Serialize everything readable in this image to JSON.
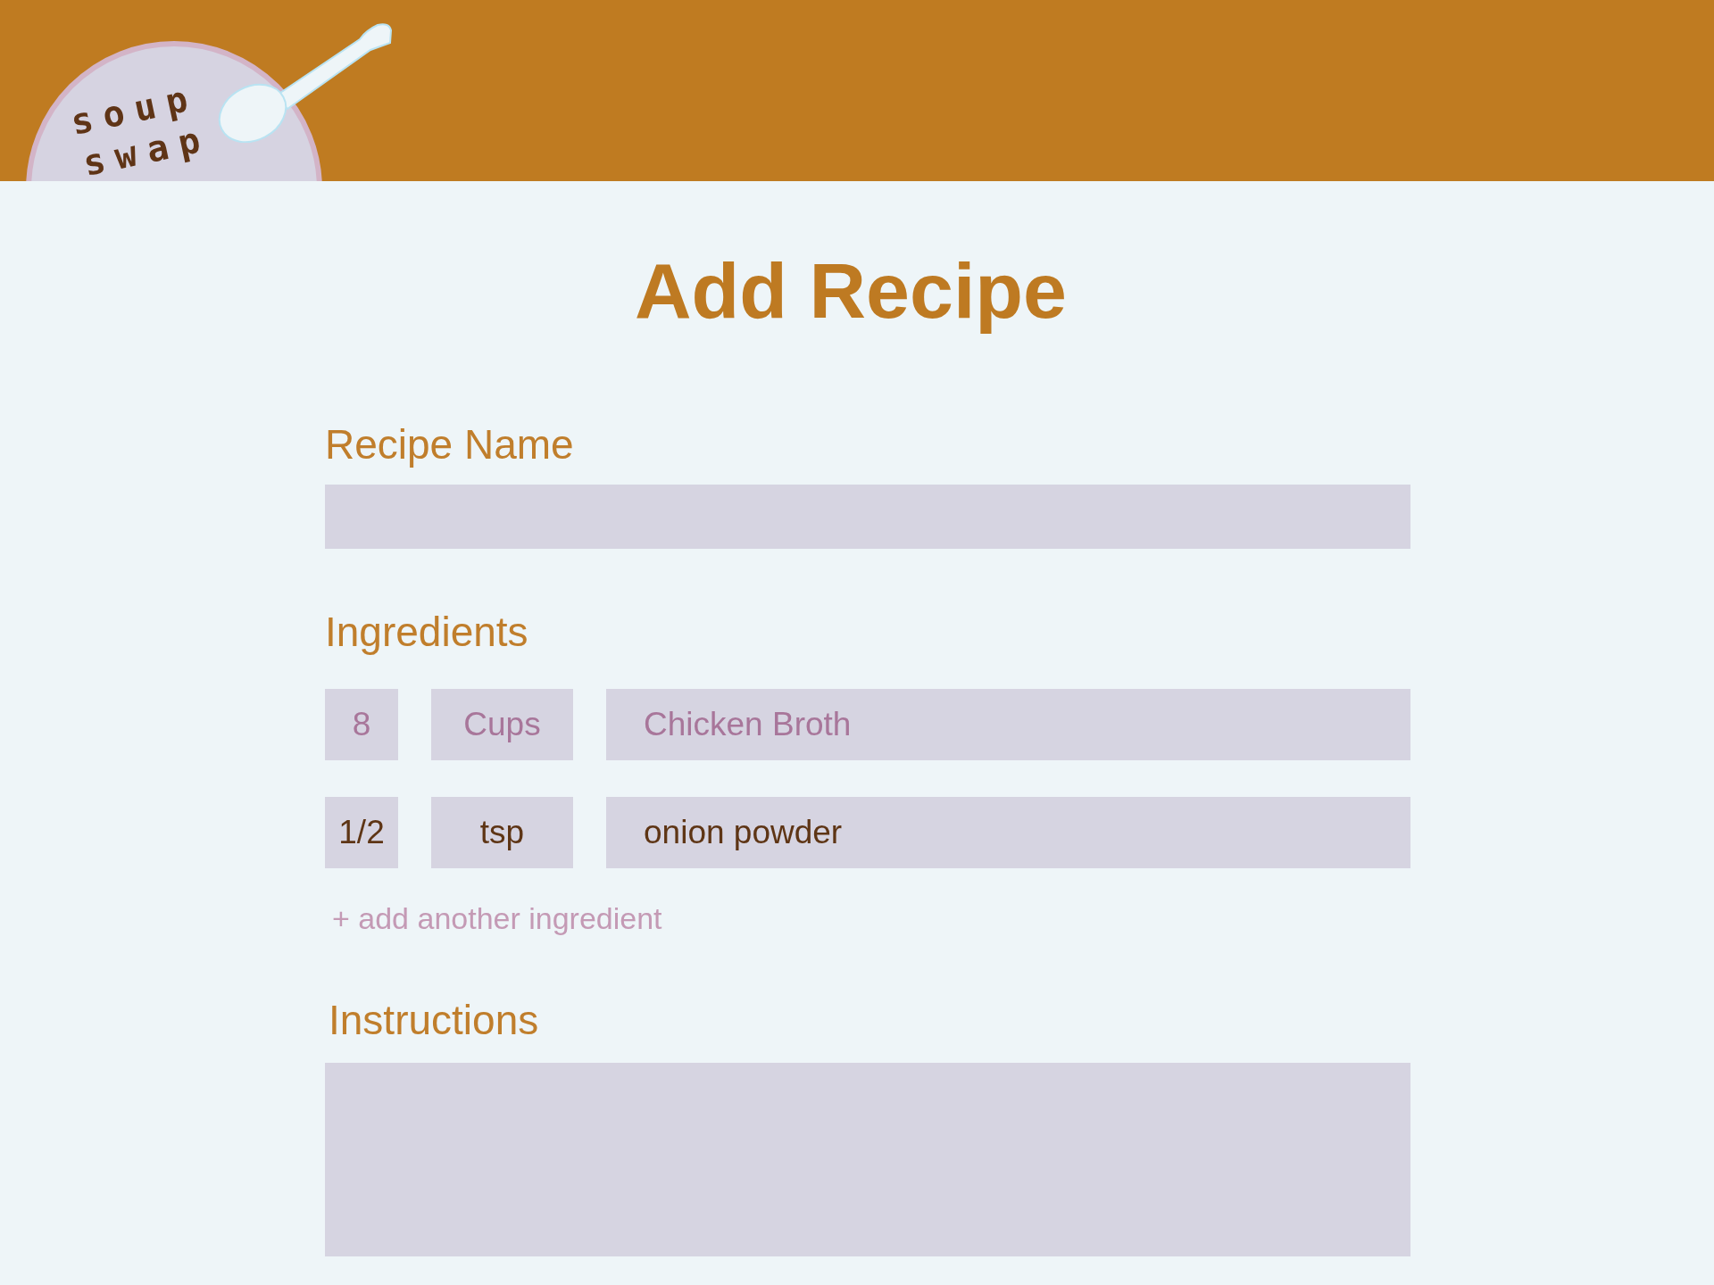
{
  "header": {
    "logo": {
      "line_1": "soup",
      "line_2": "swap"
    }
  },
  "title": "Add Recipe",
  "form": {
    "recipe_name": {
      "label": "Recipe Name"
    },
    "ingredients": {
      "label": "Ingredients",
      "rows": [
        {
          "quantity": {
            "placeholder": "8"
          },
          "unit": {
            "placeholder": "Cups"
          },
          "name": {
            "placeholder": "Chicken Broth"
          }
        },
        {
          "quantity": {
            "value": "1/2"
          },
          "unit": {
            "value": "tsp"
          },
          "name": {
            "value": "onion powder"
          }
        }
      ],
      "add_link": "+ add another ingredient"
    },
    "instructions": {
      "label": "Instructions"
    }
  }
}
